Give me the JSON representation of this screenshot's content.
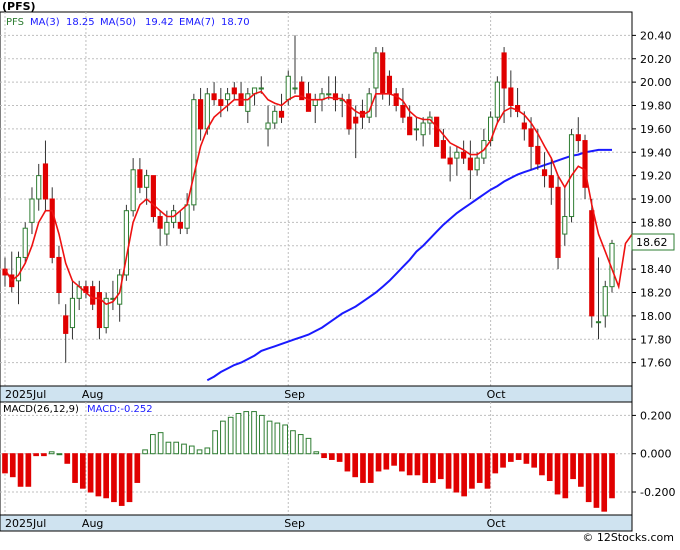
{
  "ticker_label": "(PFS)",
  "credit": "© 12Stocks.com",
  "colors": {
    "bull": "#2e7d32",
    "bear": "#e00000",
    "ma50": "#1a1aff",
    "ema7": "#ee1111",
    "ma3": "#1a1aff",
    "bg": "#ffffff",
    "grid": "#bfbfbf",
    "axisband": "#cfe3f0",
    "macdpos": "#2e7d32",
    "macdneg": "#e00000"
  },
  "legend": {
    "ticker": "PFS",
    "ma3_label": "MA(3)",
    "ma3_value": "18.25",
    "ma50_label": "MA(50)",
    "ma50_value": "19.42",
    "ema7_label": "EMA(7)",
    "ema7_value": "18.70"
  },
  "chart_data": [
    {
      "type": "candlestick",
      "ylim": [
        17.4,
        20.6
      ],
      "yticks": [
        "17.60",
        "17.80",
        "18.00",
        "18.20",
        "18.40",
        "18.60",
        "18.80",
        "19.00",
        "19.20",
        "19.40",
        "19.60",
        "19.80",
        "20.00",
        "20.20",
        "20.40"
      ],
      "xlabels": [
        {
          "label": "2025Jul",
          "index": 0
        },
        {
          "label": "Aug",
          "index": 12
        },
        {
          "label": "Sep",
          "index": 42
        },
        {
          "label": "Oct",
          "index": 72
        }
      ],
      "last_price": "18.62",
      "ohlc": [
        [
          18.4,
          18.5,
          18.25,
          18.35
        ],
        [
          18.35,
          18.55,
          18.2,
          18.25
        ],
        [
          18.3,
          18.55,
          18.1,
          18.5
        ],
        [
          18.5,
          18.8,
          18.45,
          18.75
        ],
        [
          18.8,
          19.1,
          18.7,
          19.0
        ],
        [
          19.0,
          19.3,
          18.9,
          19.2
        ],
        [
          19.3,
          19.5,
          18.9,
          19.0
        ],
        [
          19.0,
          19.1,
          18.45,
          18.5
        ],
        [
          18.5,
          18.6,
          18.1,
          18.2
        ],
        [
          18.0,
          18.1,
          17.6,
          17.85
        ],
        [
          17.9,
          18.3,
          17.8,
          18.15
        ],
        [
          18.15,
          18.3,
          18.05,
          18.25
        ],
        [
          18.25,
          18.3,
          18.15,
          18.2
        ],
        [
          18.25,
          18.3,
          18.05,
          18.1
        ],
        [
          18.2,
          18.3,
          17.8,
          17.9
        ],
        [
          17.9,
          18.2,
          17.85,
          18.15
        ],
        [
          18.15,
          18.3,
          18.05,
          18.15
        ],
        [
          18.1,
          18.4,
          17.95,
          18.35
        ],
        [
          18.35,
          18.95,
          18.3,
          18.9
        ],
        [
          18.9,
          19.35,
          18.85,
          19.25
        ],
        [
          19.25,
          19.35,
          19.05,
          19.1
        ],
        [
          19.1,
          19.25,
          18.95,
          19.2
        ],
        [
          19.2,
          19.2,
          18.8,
          18.85
        ],
        [
          18.85,
          18.9,
          18.6,
          18.75
        ],
        [
          18.7,
          18.9,
          18.6,
          18.8
        ],
        [
          18.8,
          18.95,
          18.75,
          18.9
        ],
        [
          18.8,
          18.9,
          18.7,
          18.75
        ],
        [
          18.75,
          19.05,
          18.7,
          18.95
        ],
        [
          18.95,
          19.9,
          18.9,
          19.85
        ],
        [
          19.85,
          19.95,
          19.5,
          19.6
        ],
        [
          19.6,
          19.95,
          19.55,
          19.9
        ],
        [
          19.9,
          20.0,
          19.8,
          19.85
        ],
        [
          19.85,
          19.95,
          19.7,
          19.8
        ],
        [
          19.85,
          19.95,
          19.75,
          19.9
        ],
        [
          19.95,
          20.0,
          19.85,
          19.9
        ],
        [
          19.9,
          20.0,
          19.8,
          19.8
        ],
        [
          19.75,
          19.95,
          19.65,
          19.9
        ],
        [
          19.9,
          19.95,
          19.8,
          19.95
        ],
        [
          19.95,
          20.05,
          19.9,
          19.95
        ],
        [
          19.6,
          19.8,
          19.45,
          19.65
        ],
        [
          19.65,
          19.8,
          19.6,
          19.75
        ],
        [
          19.75,
          19.9,
          19.65,
          19.7
        ],
        [
          19.85,
          20.1,
          19.8,
          20.05
        ],
        [
          19.95,
          20.4,
          19.9,
          19.95
        ],
        [
          20.0,
          20.05,
          19.85,
          19.85
        ],
        [
          19.9,
          20.0,
          19.75,
          19.75
        ],
        [
          19.8,
          19.9,
          19.65,
          19.85
        ],
        [
          19.85,
          19.95,
          19.75,
          19.9
        ],
        [
          19.9,
          20.05,
          19.85,
          19.9
        ],
        [
          19.9,
          20.05,
          19.75,
          19.85
        ],
        [
          19.85,
          19.9,
          19.7,
          19.85
        ],
        [
          19.85,
          19.9,
          19.55,
          19.6
        ],
        [
          19.7,
          19.8,
          19.35,
          19.65
        ],
        [
          19.75,
          19.85,
          19.6,
          19.7
        ],
        [
          19.7,
          19.95,
          19.65,
          19.9
        ],
        [
          19.95,
          20.3,
          19.7,
          20.25
        ],
        [
          20.25,
          20.3,
          19.85,
          19.9
        ],
        [
          20.05,
          20.1,
          19.8,
          19.9
        ],
        [
          19.9,
          19.95,
          19.75,
          19.8
        ],
        [
          19.8,
          19.95,
          19.65,
          19.7
        ],
        [
          19.7,
          19.8,
          19.6,
          19.55
        ],
        [
          19.6,
          19.7,
          19.5,
          19.6
        ],
        [
          19.55,
          19.7,
          19.45,
          19.65
        ],
        [
          19.65,
          19.75,
          19.55,
          19.7
        ],
        [
          19.7,
          19.7,
          19.55,
          19.45
        ],
        [
          19.5,
          19.6,
          19.4,
          19.35
        ],
        [
          19.35,
          19.45,
          19.15,
          19.3
        ],
        [
          19.35,
          19.45,
          19.2,
          19.4
        ],
        [
          19.4,
          19.5,
          19.3,
          19.35
        ],
        [
          19.35,
          19.5,
          19.0,
          19.25
        ],
        [
          19.25,
          19.4,
          19.2,
          19.35
        ],
        [
          19.35,
          19.6,
          19.3,
          19.5
        ],
        [
          19.5,
          19.75,
          19.45,
          19.7
        ],
        [
          19.7,
          20.05,
          19.65,
          20.0
        ],
        [
          20.25,
          20.3,
          19.65,
          19.95
        ],
        [
          19.95,
          20.1,
          19.7,
          19.8
        ],
        [
          19.8,
          19.95,
          19.7,
          19.75
        ],
        [
          19.65,
          19.75,
          19.5,
          19.6
        ],
        [
          19.6,
          19.7,
          19.25,
          19.45
        ],
        [
          19.45,
          19.6,
          19.25,
          19.3
        ],
        [
          19.25,
          19.4,
          19.1,
          19.2
        ],
        [
          19.2,
          19.35,
          18.95,
          19.1
        ],
        [
          19.1,
          19.2,
          18.4,
          18.5
        ],
        [
          18.7,
          19.1,
          18.6,
          18.85
        ],
        [
          18.85,
          19.6,
          18.8,
          19.55
        ],
        [
          19.55,
          19.7,
          19.4,
          19.5
        ],
        [
          19.5,
          19.55,
          19.0,
          19.1
        ],
        [
          18.9,
          19.0,
          17.9,
          18.0
        ],
        [
          17.95,
          18.5,
          17.8,
          17.95
        ],
        [
          18.0,
          18.3,
          17.9,
          18.25
        ],
        [
          18.25,
          18.65,
          18.2,
          18.62
        ]
      ],
      "ma50": [
        17.45,
        17.48,
        17.52,
        17.55,
        17.58,
        17.6,
        17.63,
        17.66,
        17.7,
        17.72,
        17.74,
        17.76,
        17.78,
        17.8,
        17.82,
        17.84,
        17.87,
        17.9,
        17.94,
        17.98,
        18.02,
        18.05,
        18.08,
        18.12,
        18.16,
        18.2,
        18.25,
        18.3,
        18.36,
        18.42,
        18.48,
        18.55,
        18.6,
        18.66,
        18.72,
        18.78,
        18.83,
        18.88,
        18.92,
        18.96,
        19.0,
        19.04,
        19.08,
        19.11,
        19.15,
        19.18,
        19.21,
        19.23,
        19.25,
        19.27,
        19.29,
        19.31,
        19.33,
        19.35,
        19.37,
        19.38,
        19.4,
        19.41,
        19.42,
        19.42,
        19.42
      ],
      "ema7": [
        18.4,
        18.3,
        18.35,
        18.45,
        18.6,
        18.8,
        18.9,
        18.9,
        18.7,
        18.45,
        18.3,
        18.25,
        18.2,
        18.15,
        18.15,
        18.1,
        18.12,
        18.2,
        18.5,
        18.8,
        18.95,
        19.0,
        18.95,
        18.9,
        18.85,
        18.85,
        18.9,
        18.95,
        19.2,
        19.45,
        19.6,
        19.7,
        19.75,
        19.8,
        19.85,
        19.85,
        19.85,
        19.9,
        19.92,
        19.85,
        19.82,
        19.8,
        19.85,
        19.88,
        19.88,
        19.85,
        19.85,
        19.85,
        19.87,
        19.86,
        19.86,
        19.8,
        19.75,
        19.72,
        19.75,
        19.9,
        19.9,
        19.9,
        19.88,
        19.84,
        19.75,
        19.7,
        19.68,
        19.68,
        19.62,
        19.55,
        19.48,
        19.45,
        19.42,
        19.38,
        19.38,
        19.42,
        19.5,
        19.65,
        19.75,
        19.78,
        19.76,
        19.72,
        19.65,
        19.56,
        19.45,
        19.35,
        19.2,
        19.1,
        19.2,
        19.28,
        19.25,
        18.95,
        18.7,
        18.55,
        18.4,
        18.25,
        18.62,
        18.7
      ]
    },
    {
      "type": "bar",
      "title": "MACD(26,12,9)",
      "value_label": "MACD:-0.252",
      "ylim": [
        -0.32,
        0.27
      ],
      "yticks": [
        "0.200",
        "0.000",
        "-0.200"
      ],
      "xlabels": [
        {
          "label": "2025Jul",
          "index": 0
        },
        {
          "label": "Aug",
          "index": 12
        },
        {
          "label": "Sep",
          "index": 42
        },
        {
          "label": "Oct",
          "index": 72
        }
      ],
      "values": [
        -0.1,
        -0.12,
        -0.17,
        -0.17,
        -0.01,
        -0.01,
        0.01,
        0.0,
        -0.05,
        -0.15,
        -0.18,
        -0.2,
        -0.22,
        -0.23,
        -0.25,
        -0.27,
        -0.25,
        -0.15,
        0.02,
        0.1,
        0.11,
        0.06,
        0.06,
        0.05,
        0.04,
        0.02,
        0.03,
        0.12,
        0.17,
        0.19,
        0.21,
        0.22,
        0.22,
        0.2,
        0.17,
        0.16,
        0.15,
        0.12,
        0.1,
        0.08,
        0.01,
        -0.02,
        -0.03,
        -0.04,
        -0.09,
        -0.12,
        -0.15,
        -0.15,
        -0.09,
        -0.08,
        -0.06,
        -0.09,
        -0.11,
        -0.11,
        -0.15,
        -0.15,
        -0.13,
        -0.18,
        -0.2,
        -0.22,
        -0.18,
        -0.15,
        -0.18,
        -0.1,
        -0.07,
        -0.04,
        -0.03,
        -0.05,
        -0.07,
        -0.11,
        -0.14,
        -0.21,
        -0.23,
        -0.13,
        -0.17,
        -0.25,
        -0.28,
        -0.3,
        -0.23
      ],
      "macd_line": []
    }
  ]
}
